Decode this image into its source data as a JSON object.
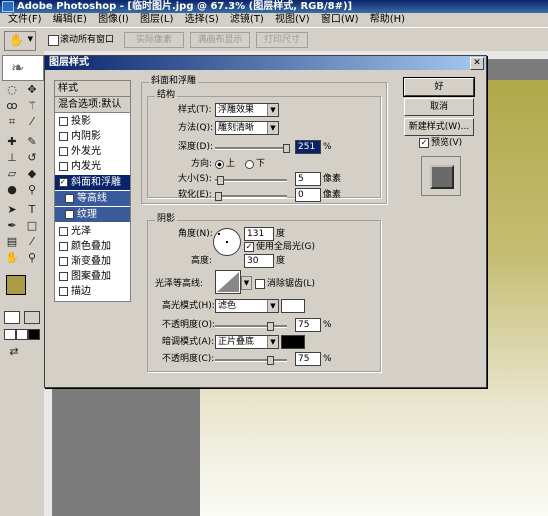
{
  "app": {
    "title": "Adobe Photoshop - [临时图片.jpg @ 67.3% (图层样式, RGB/8#)]"
  },
  "menu": [
    "文件(F)",
    "编辑(E)",
    "图像(I)",
    "图层(L)",
    "选择(S)",
    "滤镜(T)",
    "视图(V)",
    "窗口(W)",
    "帮助(H)"
  ],
  "options": {
    "scroll_all": "滚动所有窗口",
    "btn_actual": "实际像素",
    "btn_fit": "满画布显示",
    "btn_print": "打印尺寸"
  },
  "dialog": {
    "title": "图层样式",
    "styles_header": "样式",
    "blend_default": "混合选项:默认",
    "items": [
      "投影",
      "内阴影",
      "外发光",
      "内发光",
      "斜面和浮雕",
      "等高线",
      "纹理",
      "光泽",
      "颜色叠加",
      "渐变叠加",
      "图案叠加",
      "描边"
    ],
    "bevel": {
      "group_title": "斜面和浮雕",
      "structure_title": "结构",
      "style_label": "样式(T):",
      "style_value": "浮雕效果",
      "technique_label": "方法(Q):",
      "technique_value": "雕刻清晰",
      "depth_label": "深度(D):",
      "depth_value": "251",
      "depth_unit": "%",
      "direction_label": "方向:",
      "dir_up": "上",
      "dir_down": "下",
      "size_label": "大小(S):",
      "size_value": "5",
      "size_unit": "像素",
      "soften_label": "软化(E):",
      "soften_value": "0",
      "soften_unit": "像素"
    },
    "shading": {
      "title": "阴影",
      "angle_label": "角度(N):",
      "angle_value": "131",
      "angle_unit": "度",
      "global_light": "使用全局光(G)",
      "altitude_label": "高度:",
      "altitude_value": "30",
      "altitude_unit": "度",
      "gloss_label": "光泽等高线:",
      "anti_alias": "消除锯齿(L)",
      "highlight_label": "高光模式(H):",
      "highlight_value": "滤色",
      "highlight_color": "#ffffff",
      "opacity1_label": "不透明度(O):",
      "opacity1_value": "75",
      "opacity_unit": "%",
      "shadow_label": "暗调模式(A):",
      "shadow_value": "正片叠底",
      "shadow_color": "#000000",
      "opacity2_label": "不透明度(C):",
      "opacity2_value": "75"
    },
    "buttons": {
      "ok": "好",
      "cancel": "取消",
      "new_style": "新建样式(W)...",
      "preview": "预览(V)"
    }
  }
}
